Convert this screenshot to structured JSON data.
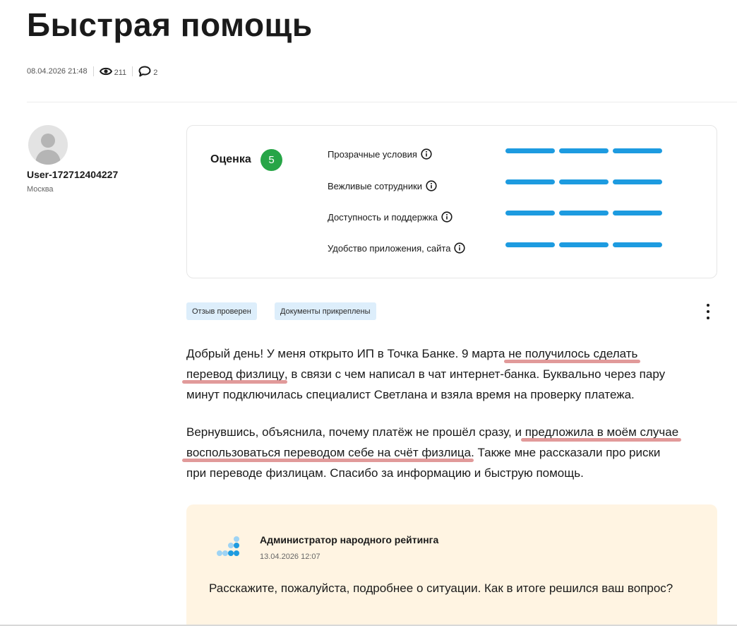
{
  "page": {
    "title": "Быстрая помощь",
    "date": "08.04.2026 21:48",
    "views": "211",
    "comments": "2"
  },
  "author": {
    "name": "User-172712404227",
    "city": "Москва"
  },
  "rating": {
    "label": "Оценка",
    "score": "5",
    "bar_color": "#1d9be0",
    "badge_color": "#27a547",
    "criteria": [
      {
        "label": "Прозрачные условия",
        "level": 3,
        "max": 3
      },
      {
        "label": "Вежливые сотрудники",
        "level": 3,
        "max": 3
      },
      {
        "label": "Доступность и поддержка",
        "level": 3,
        "max": 3
      },
      {
        "label": "Удобство приложения, сайта",
        "level": 3,
        "max": 3
      }
    ]
  },
  "tags": [
    "Отзыв проверен",
    "Документы прикреплены"
  ],
  "review": {
    "p1": {
      "l1a": "Добрый день! У меня открыто ИП в Точка Банке. 9 марта ",
      "l1u": "не получилось сделать",
      "l2u": "перевод физлицу",
      "l2b": ", в связи с чем написал в чат интернет-банка. Буквально через пару",
      "l3": "минут подключилась специалист Светлана и взяла время на проверку платежа."
    },
    "p2": {
      "l1a": "Вернувшись, объяснила, почему платёж не прошёл сразу, и ",
      "l1u": "предложила в моём случае",
      "l2u": "воспользоваться переводом себе на счёт физлица",
      "l2b": ". Также мне рассказали про риски",
      "l3": "при переводе физлицам. Спасибо за информацию и быструю помощь."
    }
  },
  "admin_reply": {
    "name": "Администратор народного рейтинга",
    "date": "13.04.2026 12:07",
    "text": "Расскажите, пожалуйста, подробнее о ситуации. Как в итоге решился ваш вопрос?",
    "logo_colors": [
      "#1d9be0",
      "#9ed3f4"
    ]
  }
}
